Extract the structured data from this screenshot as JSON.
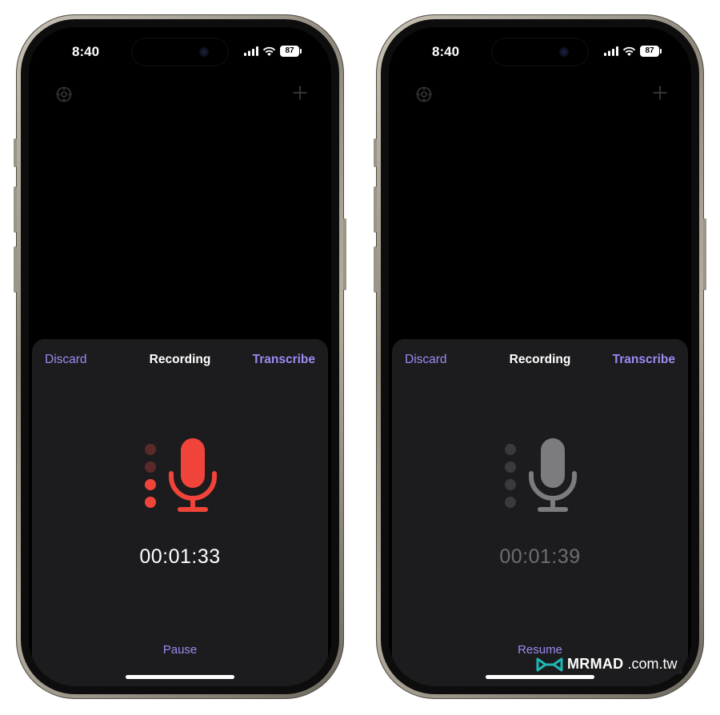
{
  "left_phone": {
    "status": {
      "time": "8:40",
      "battery": "87"
    },
    "sheet": {
      "discard_label": "Discard",
      "title": "Recording",
      "transcribe_label": "Transcribe",
      "timer": "00:01:33",
      "action_label": "Pause",
      "mic_state": "recording",
      "mic_color": "#f0443a",
      "timer_color": "#ffffff"
    }
  },
  "right_phone": {
    "status": {
      "time": "8:40",
      "battery": "87"
    },
    "sheet": {
      "discard_label": "Discard",
      "title": "Recording",
      "transcribe_label": "Transcribe",
      "timer": "00:01:39",
      "action_label": "Resume",
      "mic_state": "paused",
      "mic_color": "#7c7b80",
      "timer_color": "#6e6d72"
    }
  },
  "colors": {
    "accent": "#9d89f2",
    "sheet_background": "#1c1c1e",
    "screen_background": "#000000"
  },
  "icons": [
    "settings-gear-icon",
    "plus-icon",
    "microphone-icon",
    "signal-icon",
    "wifi-icon",
    "battery-icon"
  ],
  "watermark": {
    "brand": "MRMAD",
    "domain": ".com.tw"
  }
}
